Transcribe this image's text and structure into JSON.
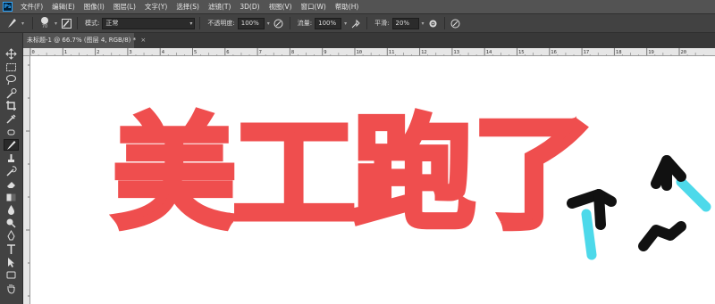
{
  "app": {
    "logo": "Ps"
  },
  "menu": [
    "文件(F)",
    "编辑(E)",
    "图像(I)",
    "图层(L)",
    "文字(Y)",
    "选择(S)",
    "滤镜(T)",
    "3D(D)",
    "视图(V)",
    "窗口(W)",
    "帮助(H)"
  ],
  "options": {
    "brush_size": "70",
    "mode_label": "模式:",
    "mode_value": "正常",
    "opacity_label": "不透明度:",
    "opacity_value": "100%",
    "flow_label": "流量:",
    "flow_value": "100%",
    "smoothing_label": "平滑:",
    "smoothing_value": "20%"
  },
  "document": {
    "tab_title": "未标题-1 @ 66.7% (图层 4, RGB/8) *",
    "close": "×"
  },
  "ruler": {
    "top_ticks": [
      "0",
      "1",
      "2",
      "3",
      "4",
      "5",
      "6",
      "7",
      "8",
      "9",
      "10",
      "11",
      "12",
      "13",
      "14",
      "15",
      "16",
      "17",
      "18",
      "19",
      "20"
    ]
  },
  "canvas": {
    "headline": "美工跑了",
    "headline_color": "#ef4e4e",
    "doodle_colors": {
      "ink": "#111111",
      "accent": "#4dd9ea"
    }
  },
  "tools": [
    "move-tool",
    "marquee-tool",
    "lasso-tool",
    "quick-select-tool",
    "crop-tool",
    "eyedropper-tool",
    "healing-tool",
    "brush-tool",
    "clone-stamp-tool",
    "history-brush-tool",
    "eraser-tool",
    "gradient-tool",
    "blur-tool",
    "dodge-tool",
    "pen-tool",
    "type-tool",
    "path-select-tool",
    "rectangle-tool",
    "hand-tool"
  ]
}
